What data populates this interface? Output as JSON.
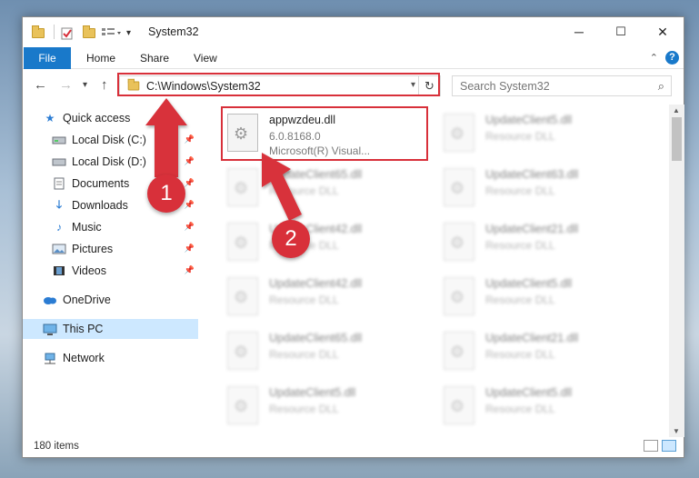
{
  "window": {
    "title": "System32",
    "minimize": "─",
    "maximize": "☐",
    "close": "✕"
  },
  "ribbon": {
    "tabs": [
      "File",
      "Home",
      "Share",
      "View"
    ],
    "help": "?"
  },
  "navbar": {
    "address": "C:\\Windows\\System32",
    "search_placeholder": "Search System32"
  },
  "sidebar": {
    "items": [
      {
        "label": "Quick access",
        "icon": "star-icon",
        "pinned": false
      },
      {
        "label": "Local Disk (C:)",
        "icon": "drive-icon",
        "pinned": true
      },
      {
        "label": "Local Disk (D:)",
        "icon": "drive-icon",
        "pinned": true
      },
      {
        "label": "Documents",
        "icon": "documents-icon",
        "pinned": true
      },
      {
        "label": "Downloads",
        "icon": "download-icon",
        "pinned": true
      },
      {
        "label": "Music",
        "icon": "music-icon",
        "pinned": true
      },
      {
        "label": "Pictures",
        "icon": "pictures-icon",
        "pinned": true
      },
      {
        "label": "Videos",
        "icon": "videos-icon",
        "pinned": true
      },
      {
        "label": "OneDrive",
        "icon": "cloud-icon",
        "pinned": false
      },
      {
        "label": "This PC",
        "icon": "computer-icon",
        "pinned": false,
        "selected": true
      },
      {
        "label": "Network",
        "icon": "network-icon",
        "pinned": false
      }
    ]
  },
  "files": {
    "highlighted": {
      "name": "appwzdeu.dll",
      "version": "6.0.8168.0",
      "company": "Microsoft(R) Visual..."
    },
    "left_column": [
      {
        "name": "UpdateClient65.dll",
        "type": "Resource DLL"
      },
      {
        "name": "UpdateClient42.dll",
        "type": "Resource DLL"
      },
      {
        "name": "UpdateClient42.dll",
        "type": "Resource DLL"
      },
      {
        "name": "UpdateClient65.dll",
        "type": "Resource DLL"
      },
      {
        "name": "UpdateClient5.dll",
        "type": "Resource DLL"
      }
    ],
    "right_column": [
      {
        "name": "UpdateClient5.dll",
        "type": "Resource DLL"
      },
      {
        "name": "UpdateClient63.dll",
        "type": "Resource DLL"
      },
      {
        "name": "UpdateClient21.dll",
        "type": "Resource DLL"
      },
      {
        "name": "UpdateClient5.dll",
        "type": "Resource DLL"
      },
      {
        "name": "UpdateClient21.dll",
        "type": "Resource DLL"
      },
      {
        "name": "UpdateClient5.dll",
        "type": "Resource DLL"
      }
    ]
  },
  "status": {
    "items": "180 items"
  },
  "annotations": {
    "step1": "1",
    "step2": "2",
    "color": "#d8303a"
  }
}
